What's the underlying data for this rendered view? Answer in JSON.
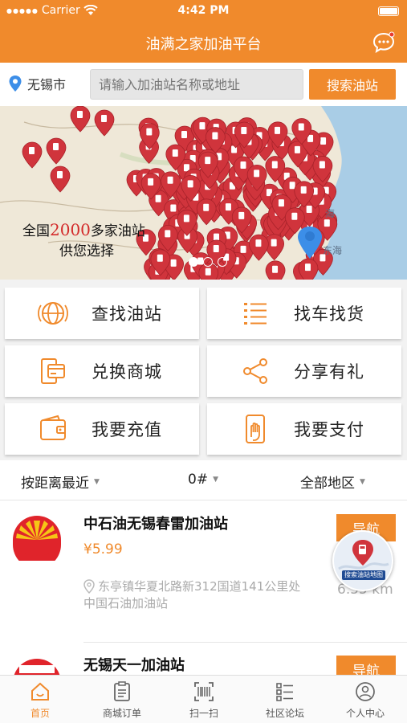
{
  "status_bar": {
    "carrier": "Carrier",
    "time": "4:42 PM"
  },
  "header": {
    "title": "油满之家加油平台",
    "message_icon": "chat-bubble-icon"
  },
  "search": {
    "city": "无锡市",
    "placeholder": "请输入加油站名称或地址",
    "button_label": "搜索油站"
  },
  "banner": {
    "caption_prefix": "全国",
    "caption_number": "2000",
    "caption_suffix": "多家油站",
    "caption_line2": "供您选择",
    "sea_label_1": "海",
    "sea_label_2": "东海"
  },
  "functions": [
    {
      "label": "查找油站",
      "icon": "globe-icon"
    },
    {
      "label": "找车找货",
      "icon": "list-icon"
    },
    {
      "label": "兑换商城",
      "icon": "phone-card-icon"
    },
    {
      "label": "分享有礼",
      "icon": "share-icon"
    },
    {
      "label": "我要充值",
      "icon": "wallet-icon"
    },
    {
      "label": "我要支付",
      "icon": "phone-tap-icon"
    }
  ],
  "filters": {
    "sort": "按距离最近",
    "fuel": "0#",
    "region": "全部地区"
  },
  "stations": [
    {
      "name": "中石油无锡春雷加油站",
      "price": "¥5.99",
      "address": "东亭镇华夏北路新312国道141公里处中国石油加油站",
      "nav_label": "导航",
      "distance": "6.55 km"
    },
    {
      "name": "无锡天一加油站",
      "nav_label": "导航"
    }
  ],
  "floating_badge": {
    "text": "搜索油站地图"
  },
  "tabs": [
    {
      "label": "首页",
      "icon": "home-icon",
      "active": true
    },
    {
      "label": "商城订单",
      "icon": "clipboard-icon",
      "active": false
    },
    {
      "label": "扫一扫",
      "icon": "scan-icon",
      "active": false
    },
    {
      "label": "社区论坛",
      "icon": "forum-icon",
      "active": false
    },
    {
      "label": "个人中心",
      "icon": "user-icon",
      "active": false
    }
  ],
  "colors": {
    "brand": "#f08a2c",
    "map_pin": "#d0343c",
    "location_pin": "#3c8ee8"
  }
}
